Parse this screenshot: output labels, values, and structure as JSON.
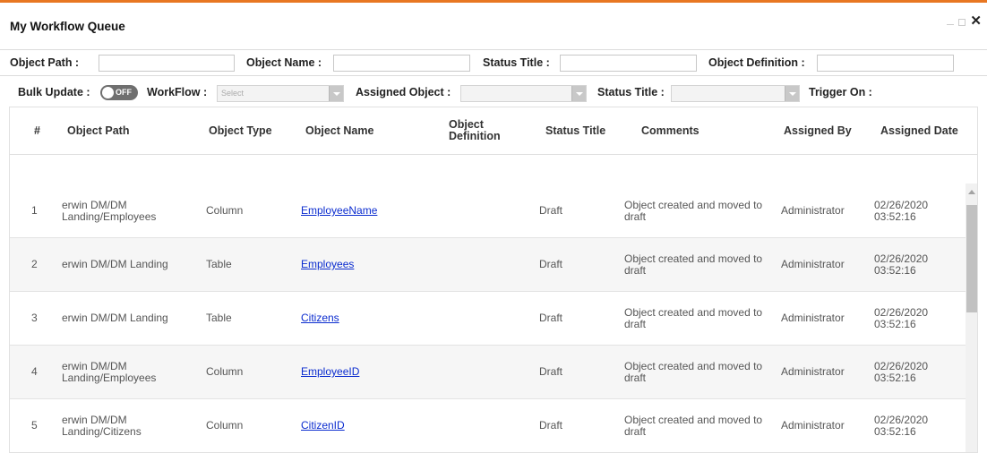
{
  "window": {
    "title": "My Workflow Queue"
  },
  "filters": {
    "object_path_label": "Object Path :",
    "object_name_label": "Object Name :",
    "status_title_label": "Status Title :",
    "object_definition_label": "Object Definition :",
    "bulk_update_label": "Bulk Update :",
    "bulk_update_state": "OFF",
    "workflow_label": "WorkFlow :",
    "workflow_placeholder": "Select",
    "assigned_object_label": "Assigned Object :",
    "status_title2_label": "Status Title :",
    "trigger_on_label": "Trigger On :"
  },
  "table": {
    "headers": {
      "num": "#",
      "path": "Object Path",
      "type": "Object Type",
      "name": "Object Name",
      "def": "Object Definition",
      "status": "Status Title",
      "comments": "Comments",
      "by": "Assigned By",
      "date": "Assigned Date"
    },
    "rows": [
      {
        "num": "1",
        "path": "erwin DM/DM Landing/Employees",
        "type": "Column",
        "name": "EmployeeName",
        "def": "",
        "status": "Draft",
        "comments": "Object created and moved to draft",
        "by": "Administrator",
        "date": "02/26/2020 03:52:16"
      },
      {
        "num": "2",
        "path": "erwin DM/DM Landing",
        "type": "Table",
        "name": "Employees",
        "def": "",
        "status": "Draft",
        "comments": "Object created and moved to draft",
        "by": "Administrator",
        "date": "02/26/2020 03:52:16"
      },
      {
        "num": "3",
        "path": "erwin DM/DM Landing",
        "type": "Table",
        "name": "Citizens",
        "def": "",
        "status": "Draft",
        "comments": "Object created and moved to draft",
        "by": "Administrator",
        "date": "02/26/2020 03:52:16"
      },
      {
        "num": "4",
        "path": "erwin DM/DM Landing/Employees",
        "type": "Column",
        "name": "EmployeeID",
        "def": "",
        "status": "Draft",
        "comments": "Object created and moved to draft",
        "by": "Administrator",
        "date": "02/26/2020 03:52:16"
      },
      {
        "num": "5",
        "path": "erwin DM/DM Landing/Citizens",
        "type": "Column",
        "name": "CitizenID",
        "def": "",
        "status": "Draft",
        "comments": "Object created and moved to draft",
        "by": "Administrator",
        "date": "02/26/2020 03:52:16"
      }
    ]
  }
}
